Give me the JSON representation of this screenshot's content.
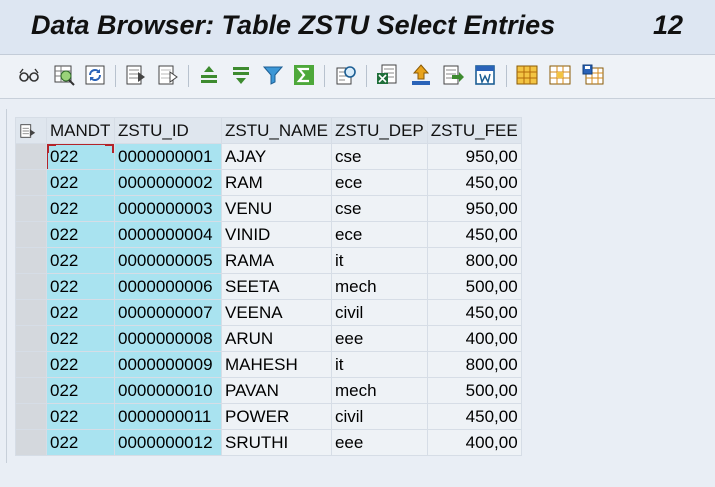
{
  "window": {
    "title": "Data Browser: Table ZSTU Select Entries",
    "entry_count": "12"
  },
  "toolbar": {
    "icons": [
      "glasses-display-icon",
      "check-table-icon",
      "refresh-icon",
      "select-all-icon",
      "deselect-all-icon",
      "sort-ascending-icon",
      "sort-descending-icon",
      "filter-icon",
      "sum-icon",
      "print-preview-icon",
      "export-excel-icon",
      "upload-icon",
      "download-icon",
      "word-processing-icon",
      "change-layout-icon",
      "select-layout-icon",
      "save-layout-icon"
    ]
  },
  "table": {
    "headers": [
      "MANDT",
      "ZSTU_ID",
      "ZSTU_NAME",
      "ZSTU_DEP",
      "ZSTU_FEE"
    ],
    "rows": [
      [
        "022",
        "0000000001",
        "AJAY",
        "cse",
        "950,00"
      ],
      [
        "022",
        "0000000002",
        "RAM",
        "ece",
        "450,00"
      ],
      [
        "022",
        "0000000003",
        "VENU",
        "cse",
        "950,00"
      ],
      [
        "022",
        "0000000004",
        "VINID",
        "ece",
        "450,00"
      ],
      [
        "022",
        "0000000005",
        "RAMA",
        "it",
        "800,00"
      ],
      [
        "022",
        "0000000006",
        "SEETA",
        "mech",
        "500,00"
      ],
      [
        "022",
        "0000000007",
        "VEENA",
        "civil",
        "450,00"
      ],
      [
        "022",
        "0000000008",
        "ARUN",
        "eee",
        "400,00"
      ],
      [
        "022",
        "0000000009",
        "MAHESH",
        "it",
        "800,00"
      ],
      [
        "022",
        "0000000010",
        "PAVAN",
        "mech",
        "500,00"
      ],
      [
        "022",
        "0000000011",
        "POWER",
        "civil",
        "450,00"
      ],
      [
        "022",
        "0000000012",
        "SRUTHI",
        "eee",
        "400,00"
      ]
    ]
  },
  "colors": {
    "key_column_bg": "#a9e3f0",
    "value_column_bg": "#eef2f6",
    "header_bg": "#dfe6ee",
    "focus_border": "#b3242a"
  }
}
